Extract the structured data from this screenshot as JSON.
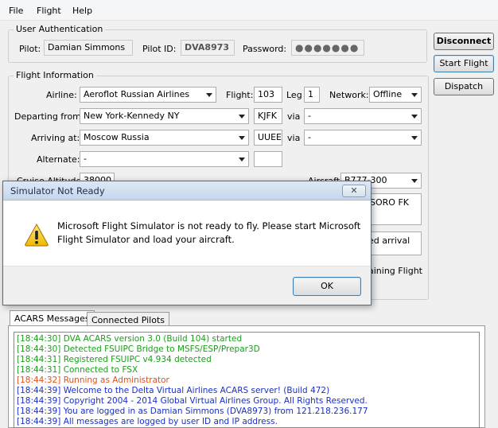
{
  "menu": {
    "file": "File",
    "flight": "Flight",
    "help": "Help"
  },
  "user_auth": {
    "title": "User Authentication",
    "pilot_label": "Pilot:",
    "pilot_value": "Damian Simmons",
    "pilot_id_label": "Pilot ID:",
    "pilot_id_value": "DVA8973",
    "password_label": "Password:",
    "password_value": "●●●●●●●"
  },
  "buttons": {
    "disconnect": "Disconnect",
    "start_flight": "Start Flight",
    "dispatch": "Dispatch"
  },
  "flight_info": {
    "title": "Flight Information",
    "airline_label": "Airline:",
    "airline_value": "Aeroflot Russian Airlines",
    "flight_label": "Flight:",
    "flight_value": "103",
    "leg_label": "Leg",
    "leg_value": "1",
    "network_label": "Network:",
    "network_value": "Offline",
    "departing_label": "Departing from:",
    "departing_value": "New York-Kennedy NY",
    "departing_code": "KJFK",
    "via_label": "via",
    "departing_via": "-",
    "arriving_label": "Arriving at:",
    "arriving_value": "Moscow Russia",
    "arriving_code": "UUEE",
    "arriving_via": "-",
    "alternate_label": "Alternate:",
    "alternate_value": "-",
    "cruise_label": "Cruise Altitude:",
    "cruise_value": "38000",
    "aircraft_label": "Aircraft:",
    "aircraft_value": "B777-300",
    "route_partial": "SORO FK",
    "remarks_partial": "ed arrival",
    "training_partial": "aining Flight"
  },
  "dialog": {
    "title": "Simulator Not Ready",
    "close": "✕",
    "message_line1": "Microsoft Flight Simulator is not ready to fly. Please start Microsoft",
    "message_line2": "Flight Simulator and load your aircraft.",
    "ok": "OK"
  },
  "tabs": {
    "acars": "ACARS Messages",
    "pilots": "Connected Pilots"
  },
  "log": [
    {
      "text": "[18:44:30] DVA ACARS version 3.0 (Build 104) started",
      "color": "#1a9e1a"
    },
    {
      "text": "[18:44:30] Detected FSUIPC Bridge to MSFS/ESP/Prepar3D",
      "color": "#1a9e1a"
    },
    {
      "text": "[18:44:31] Registered FSUIPC v4.934 detected",
      "color": "#1a9e1a"
    },
    {
      "text": "[18:44:31] Connected to FSX",
      "color": "#1a9e1a"
    },
    {
      "text": "[18:44:32] Running as Administrator",
      "color": "#e0501a"
    },
    {
      "text": "[18:44:39] Welcome to the Delta Virtual Airlines ACARS server! (Build 472)",
      "color": "#1a2fc8"
    },
    {
      "text": "[18:44:39] Copyright 2004 - 2014 Global Virtual Airlines Group. All Rights Reserved.",
      "color": "#1a2fc8"
    },
    {
      "text": "[18:44:39] You are logged in as Damian Simmons (DVA8973) from 121.218.236.177",
      "color": "#1a2fc8"
    },
    {
      "text": "[18:44:39] All messages are logged by user ID and IP address.",
      "color": "#1a2fc8"
    }
  ]
}
